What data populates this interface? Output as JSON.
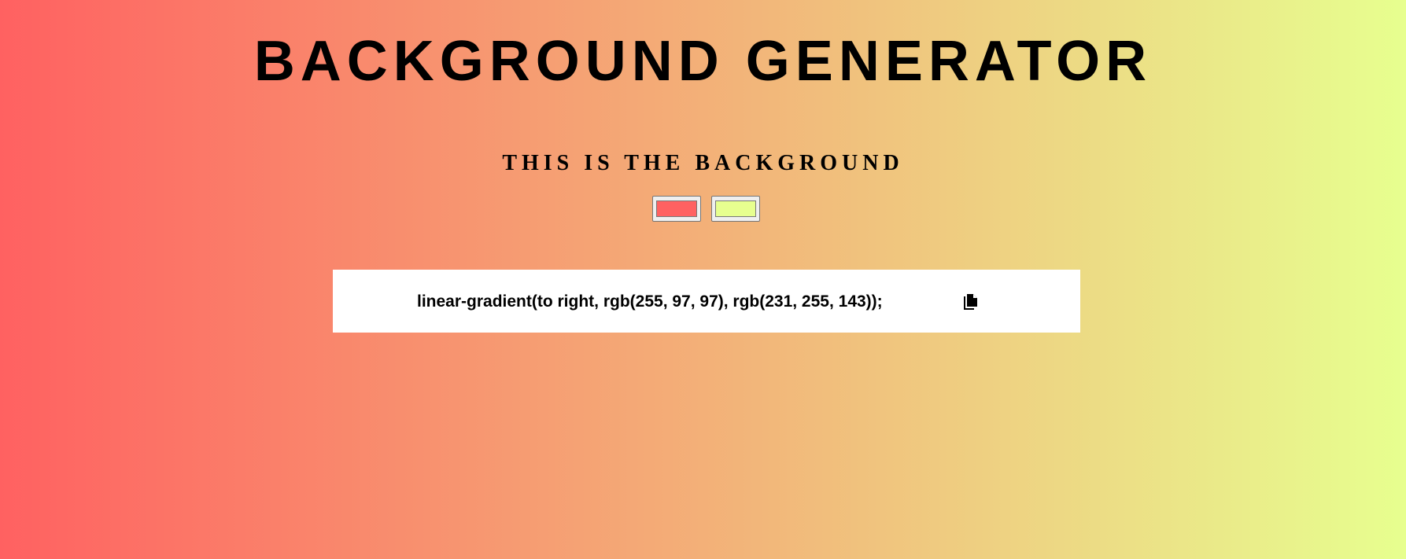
{
  "page": {
    "title": "BACKGROUND GENERATOR",
    "subtitle": "THIS IS THE BACKGROUND"
  },
  "colors": {
    "color1": "#ff6161",
    "color2": "#e7ff8f"
  },
  "output": {
    "css_text": "linear-gradient(to right, rgb(255, 97, 97), rgb(231, 255, 143));",
    "copy_icon": "copy-icon"
  }
}
